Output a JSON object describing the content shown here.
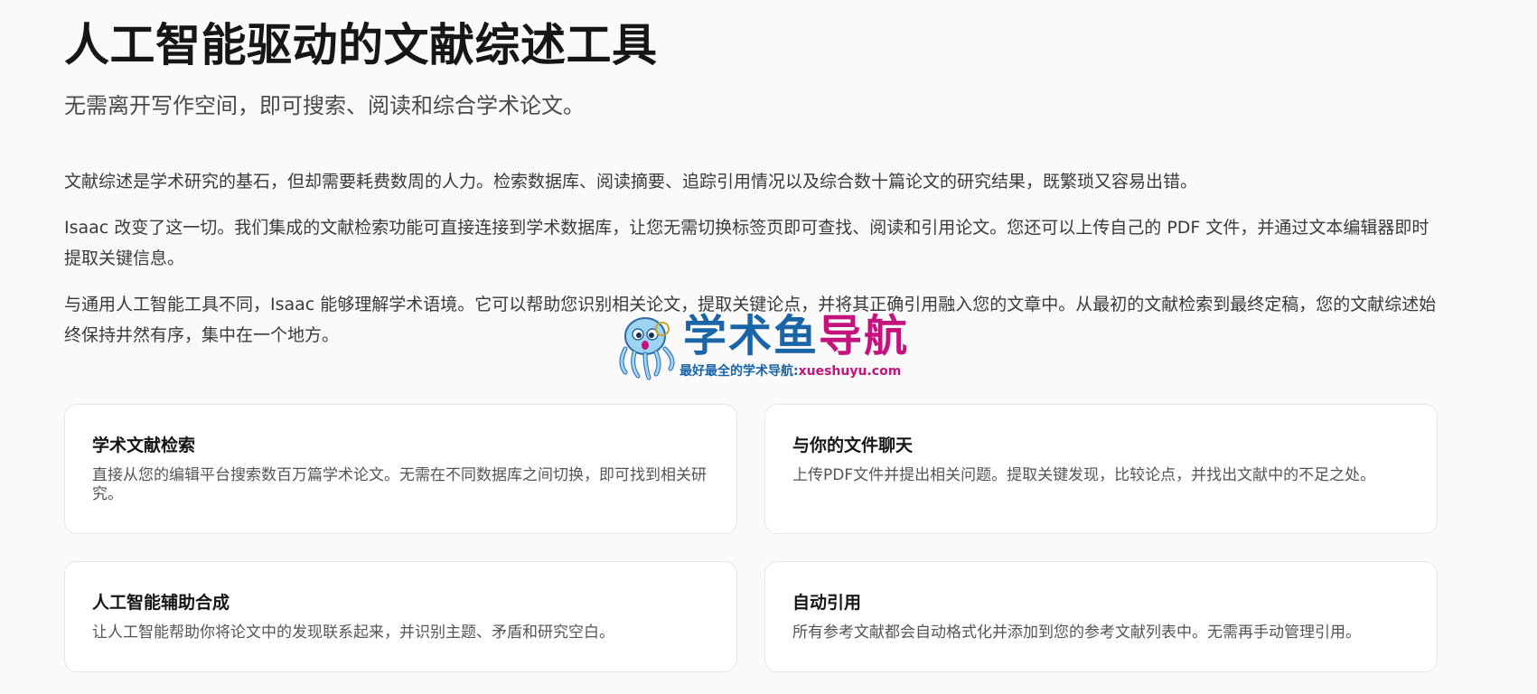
{
  "hero": {
    "title": "人工智能驱动的文献综述工具",
    "subtitle": "无需离开写作空间，即可搜索、阅读和综合学术论文。"
  },
  "paragraphs": [
    "文献综述是学术研究的基石，但却需要耗费数周的人力。检索数据库、阅读摘要、追踪引用情况以及综合数十篇论文的研究结果，既繁琐又容易出错。",
    "Isaac 改变了这一切。我们集成的文献检索功能可直接连接到学术数据库，让您无需切换标签页即可查找、阅读和引用论文。您还可以上传自己的 PDF 文件，并通过文本编辑器即时提取关键信息。",
    "与通用人工智能工具不同，Isaac 能够理解学术语境。它可以帮助您识别相关论文，提取关键论点，并将其正确引用融入您的文章中。从最初的文献检索到最终定稿，您的文献综述始终保持井然有序，集中在一个地方。"
  ],
  "features": [
    {
      "title": "学术文献检索",
      "description": "直接从您的编辑平台搜索数百万篇学术论文。无需在不同数据库之间切换，即可找到相关研究。"
    },
    {
      "title": "与你的文件聊天",
      "description": "上传PDF文件并提出相关问题。提取关键发现，比较论点，并找出文献中的不足之处。"
    },
    {
      "title": "人工智能辅助合成",
      "description": "让人工智能帮助你将论文中的发现联系起来，并识别主题、矛盾和研究空白。"
    },
    {
      "title": "自动引用",
      "description": "所有参考文献都会自动格式化并添加到您的参考文献列表中。无需再手动管理引用。"
    }
  ],
  "watermark": {
    "name_part1": "学术鱼",
    "name_part2": "导航",
    "tagline": "最好最全的学术导航:",
    "url": "xueshuyu.com",
    "icon": "octopus-mascot-icon",
    "colors": {
      "primary": "#1a64a8",
      "accent": "#c4137c"
    }
  }
}
